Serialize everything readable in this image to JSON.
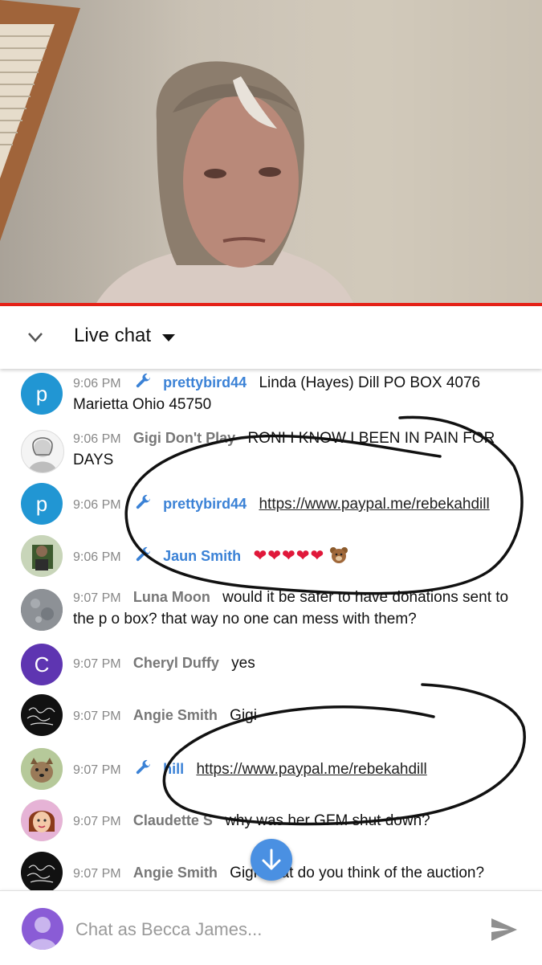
{
  "header": {
    "title": "Live chat"
  },
  "messages": [
    {
      "time": "9:06 PM",
      "author": "prettybird44",
      "moderator": true,
      "text": "Linda (Hayes) Dill PO BOX 4076 Marietta Ohio 45750",
      "avatar_letter": "p",
      "avatar_color": "#2196d3"
    },
    {
      "time": "9:06 PM",
      "author": "Gigi Don't Play",
      "moderator": false,
      "text": "RONI I KNOW I BEEN IN PAIN FOR DAYS"
    },
    {
      "time": "9:06 PM",
      "author": "prettybird44",
      "moderator": true,
      "text": "https://www.paypal.me/rebekahdill",
      "avatar_letter": "p",
      "avatar_color": "#2196d3"
    },
    {
      "time": "9:06 PM",
      "author": "Jaun Smith",
      "moderator": true,
      "text": ""
    },
    {
      "time": "9:07 PM",
      "author": "Luna Moon",
      "moderator": false,
      "text": "would it be safer to have donations sent to the p o box? that way no one can mess with them?"
    },
    {
      "time": "9:07 PM",
      "author": "Cheryl Duffy",
      "moderator": false,
      "text": "yes",
      "avatar_letter": "C",
      "avatar_color": "#5e35b1"
    },
    {
      "time": "9:07 PM",
      "author": "Angie Smith",
      "moderator": false,
      "text": "Gigi"
    },
    {
      "time": "9:07 PM",
      "author": "hill",
      "moderator": true,
      "text": "https://www.paypal.me/rebekahdill"
    },
    {
      "time": "9:07 PM",
      "author": "Claudette S",
      "moderator": false,
      "text": "why was her GFM shut down?"
    },
    {
      "time": "9:07 PM",
      "author": "Angie Smith",
      "moderator": false,
      "text": "Gigi what do you think of the auction?"
    }
  ],
  "input": {
    "placeholder": "Chat as Becca James..."
  },
  "colors": {
    "progress": "#e62117",
    "moderator": "#3b82d6",
    "fab": "#4a90e2"
  },
  "icons": [
    "chevron-down-icon",
    "dropdown-caret-icon",
    "wrench-icon",
    "arrow-down-icon",
    "send-icon",
    "heart-icon",
    "bear-icon"
  ]
}
